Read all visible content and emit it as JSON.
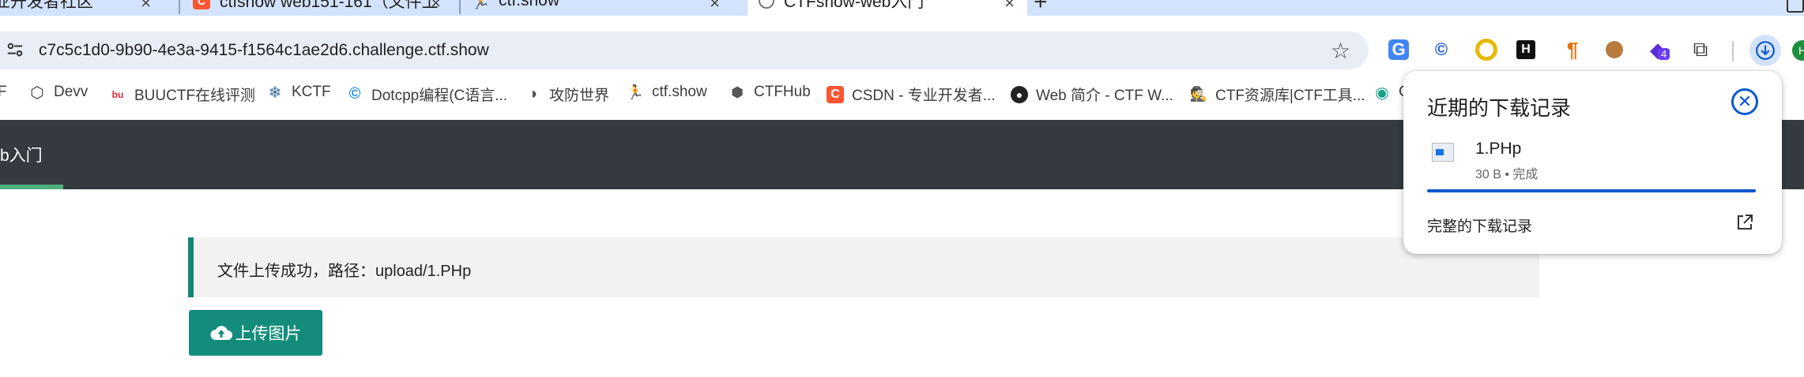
{
  "browser": {
    "tabs": [
      {
        "title": "业开发者社区",
        "active": false
      },
      {
        "title": "ctfshow web151-161（文件上",
        "active": false
      },
      {
        "title": "ctf.show",
        "active": false
      },
      {
        "title": "CTFshow-web入门",
        "active": true
      }
    ],
    "new_tab_label": "+",
    "close_glyph": "×",
    "address": {
      "url": "c7c5c1d0-9b90-4e3a-9415-f1564c1ae2d6.challenge.ctf.show"
    },
    "extensions": [
      {
        "icon": "google-translate-icon",
        "glyph": "G"
      },
      {
        "icon": "copyright-extension-icon",
        "glyph": "©"
      },
      {
        "icon": "yellow-circle-extension-icon",
        "glyph": "◎"
      },
      {
        "icon": "h-extension-icon",
        "glyph": "H"
      },
      {
        "icon": "pilcrow-extension-icon",
        "glyph": "¶"
      },
      {
        "icon": "cookie-extension-icon",
        "glyph": "🍪"
      },
      {
        "icon": "badge-extension-icon",
        "glyph": "◆",
        "badge": "4"
      },
      {
        "icon": "puzzle-extensions-icon",
        "glyph": "⧉"
      }
    ],
    "avatar_glyph": "H",
    "bookmarks": [
      {
        "label": "F",
        "icon": "none"
      },
      {
        "label": "Devv",
        "icon": "cube-icon"
      },
      {
        "label": "BUUCTF在线评测",
        "icon": "buu-icon"
      },
      {
        "label": "KCTF",
        "icon": "snowflake-icon"
      },
      {
        "label": "Dotcpp编程(C语言...",
        "icon": "dotcpp-icon"
      },
      {
        "label": "攻防世界",
        "icon": "globe-icon"
      },
      {
        "label": "ctf.show",
        "icon": "runner-icon"
      },
      {
        "label": "CTFHub",
        "icon": "ctfhub-icon"
      },
      {
        "label": "CSDN - 专业开发者...",
        "icon": "csdn-icon"
      },
      {
        "label": "Web 简介 - CTF W...",
        "icon": "github-icon"
      },
      {
        "label": "CTF资源库|CTF工具...",
        "icon": "spy-icon"
      },
      {
        "label": "C",
        "icon": "eye-icon"
      }
    ]
  },
  "page": {
    "nav_title": "b入门",
    "alert_text": "文件上传成功，路径：upload/1.PHp",
    "upload_button": "上传图片"
  },
  "downloads": {
    "title": "近期的下载记录",
    "file_name": "1.PHp",
    "file_meta": "30 B • 完成",
    "progress": 1.0,
    "full_history": "完整的下载记录"
  },
  "colors": {
    "accent": "#0b57d0",
    "navbar": "#343a40",
    "button": "#148c7c"
  }
}
